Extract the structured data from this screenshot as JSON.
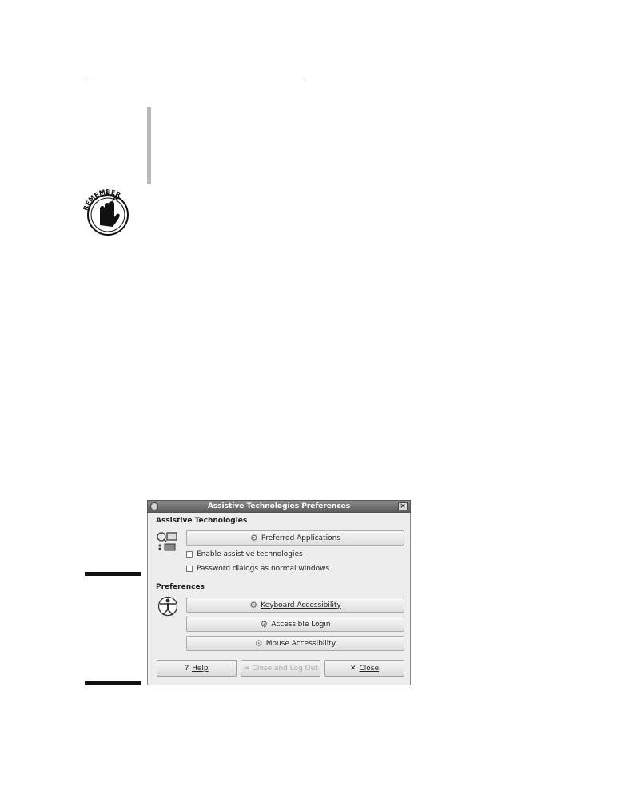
{
  "dialog": {
    "title": "Assistive Technologies Preferences",
    "section_assistive": "Assistive Technologies",
    "preferred_apps_label": "Preferred Applications",
    "enable_at_label": "Enable assistive technologies",
    "enable_at_checked": false,
    "password_dialogs_label": "Password dialogs as normal windows",
    "password_dialogs_checked": false,
    "section_preferences": "Preferences",
    "keyboard_label": "Keyboard Accessibility",
    "login_label": "Accessible Login",
    "mouse_label": "Mouse Accessibility",
    "help_label": "Help",
    "logout_label": "Close and Log Out",
    "close_label": "Close"
  },
  "sidebar_icon_text": "REMEMBER",
  "icons": {
    "preferences": "accessibility-apps-icon",
    "vitruvian": "vitruvian-man-icon",
    "button": "gear-icon"
  }
}
